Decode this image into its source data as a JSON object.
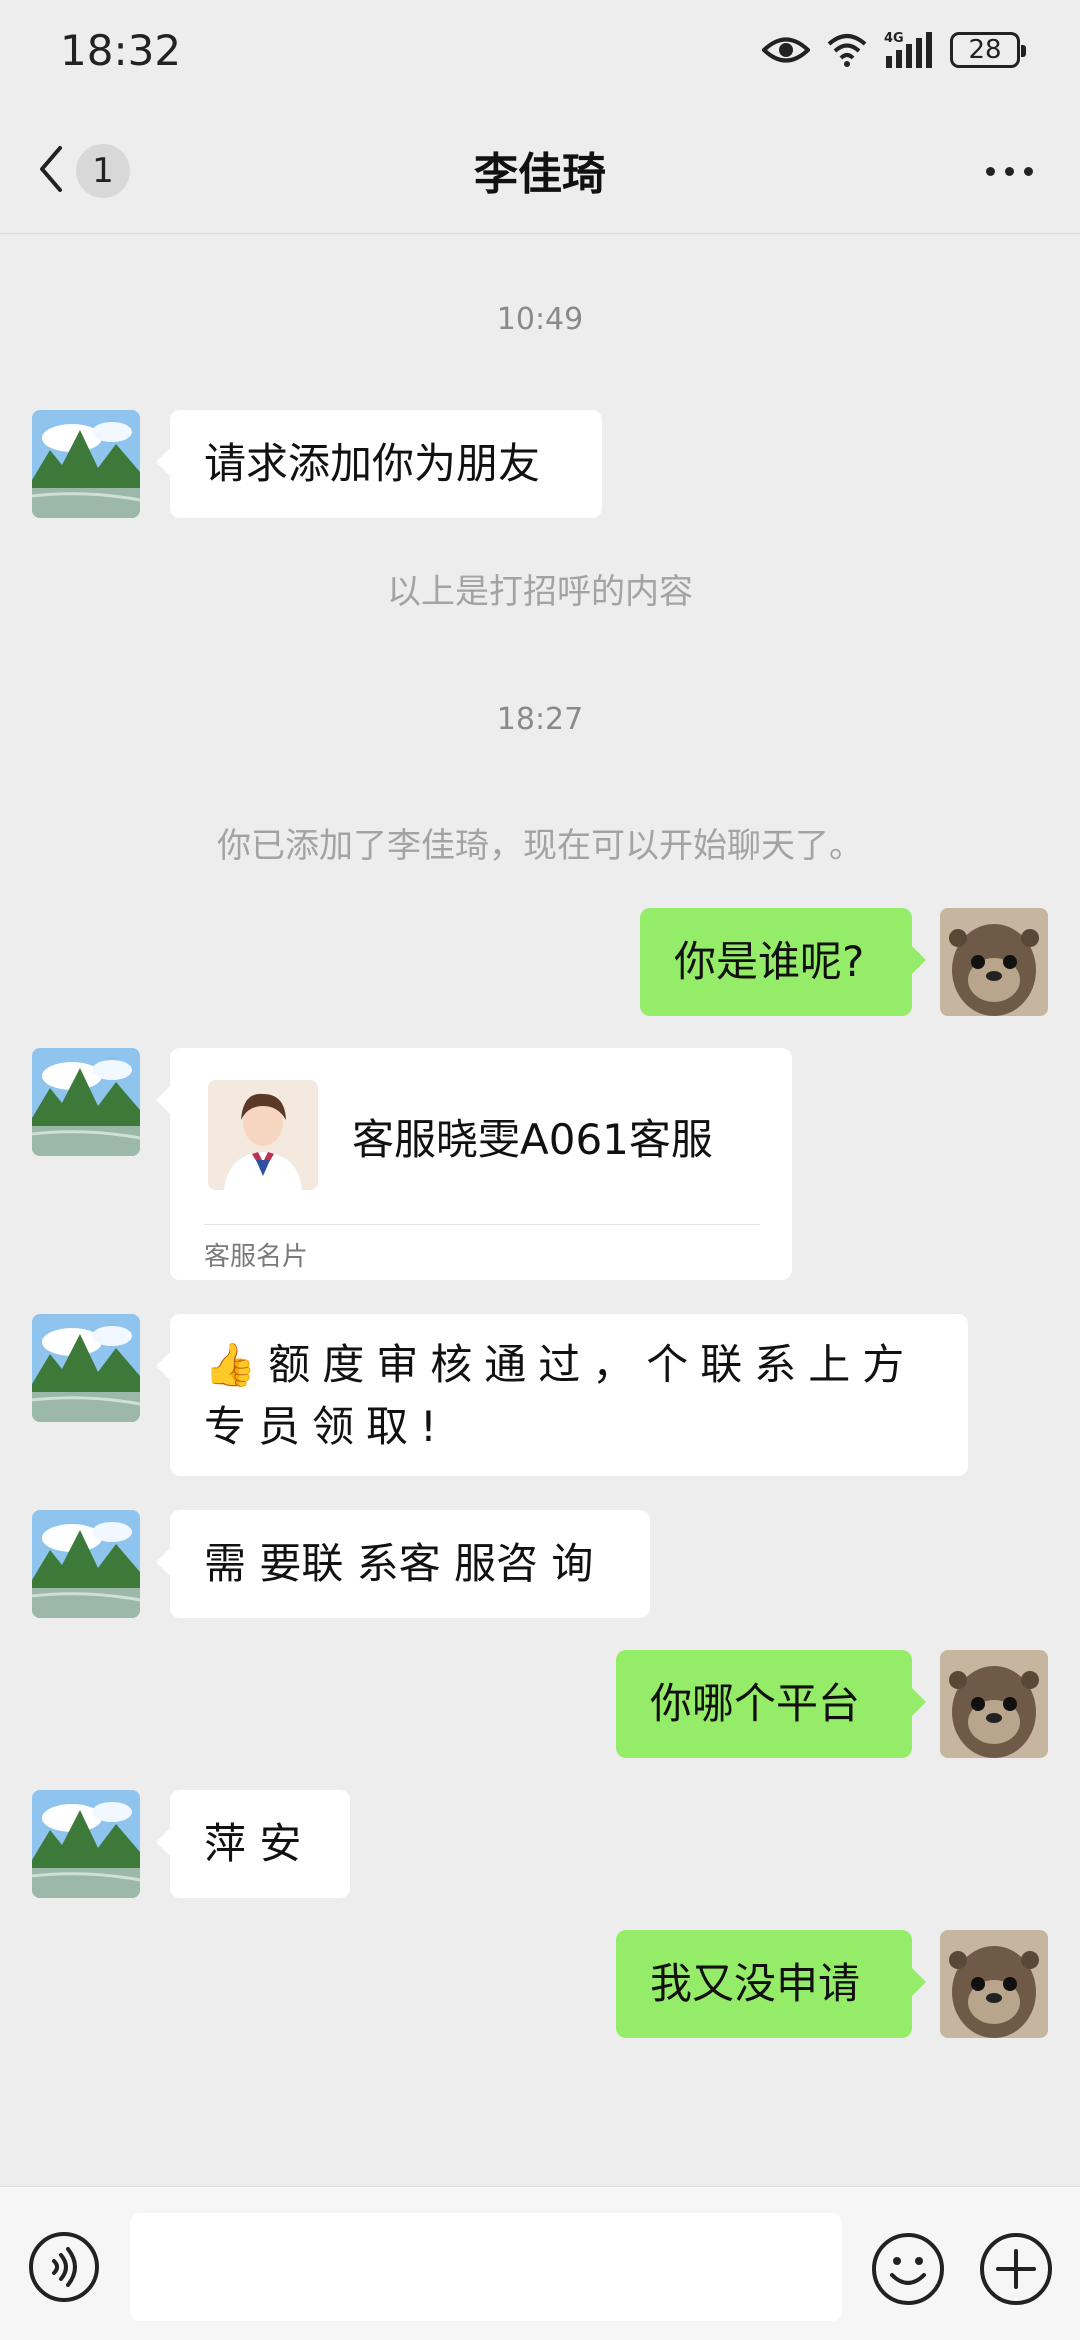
{
  "status_bar": {
    "time": "18:32",
    "battery": "28",
    "network": "4G"
  },
  "header": {
    "back_count": "1",
    "title": "李佳琦"
  },
  "chat": {
    "ts1": "10:49",
    "msg_greeting": "请求添加你为朋友",
    "sys_greeting_note": "以上是打招呼的内容",
    "ts2": "18:27",
    "sys_added": "你已添加了李佳琦，现在可以开始聊天了。",
    "msg_who": "你是谁呢?",
    "card": {
      "name": "客服晓雯A061客服",
      "label": "客服名片"
    },
    "msg_approved_line1": "👍额度审核通过，个联系上方",
    "msg_approved_line2": "专员领取!",
    "msg_contact": "需 要联 系客 服咨 询",
    "msg_which_platform": "你哪个平台",
    "msg_pingan": "萍 安",
    "msg_not_applied": "我又没申请"
  },
  "input": {
    "value": ""
  },
  "colors": {
    "background": "#ededed",
    "outgoing_bubble": "#95ec69",
    "incoming_bubble": "#ffffff"
  },
  "icons": [
    "back-icon",
    "more-icon",
    "eye-icon",
    "wifi-icon",
    "signal-icon",
    "battery-icon",
    "voice-icon",
    "emoji-icon",
    "plus-icon"
  ]
}
